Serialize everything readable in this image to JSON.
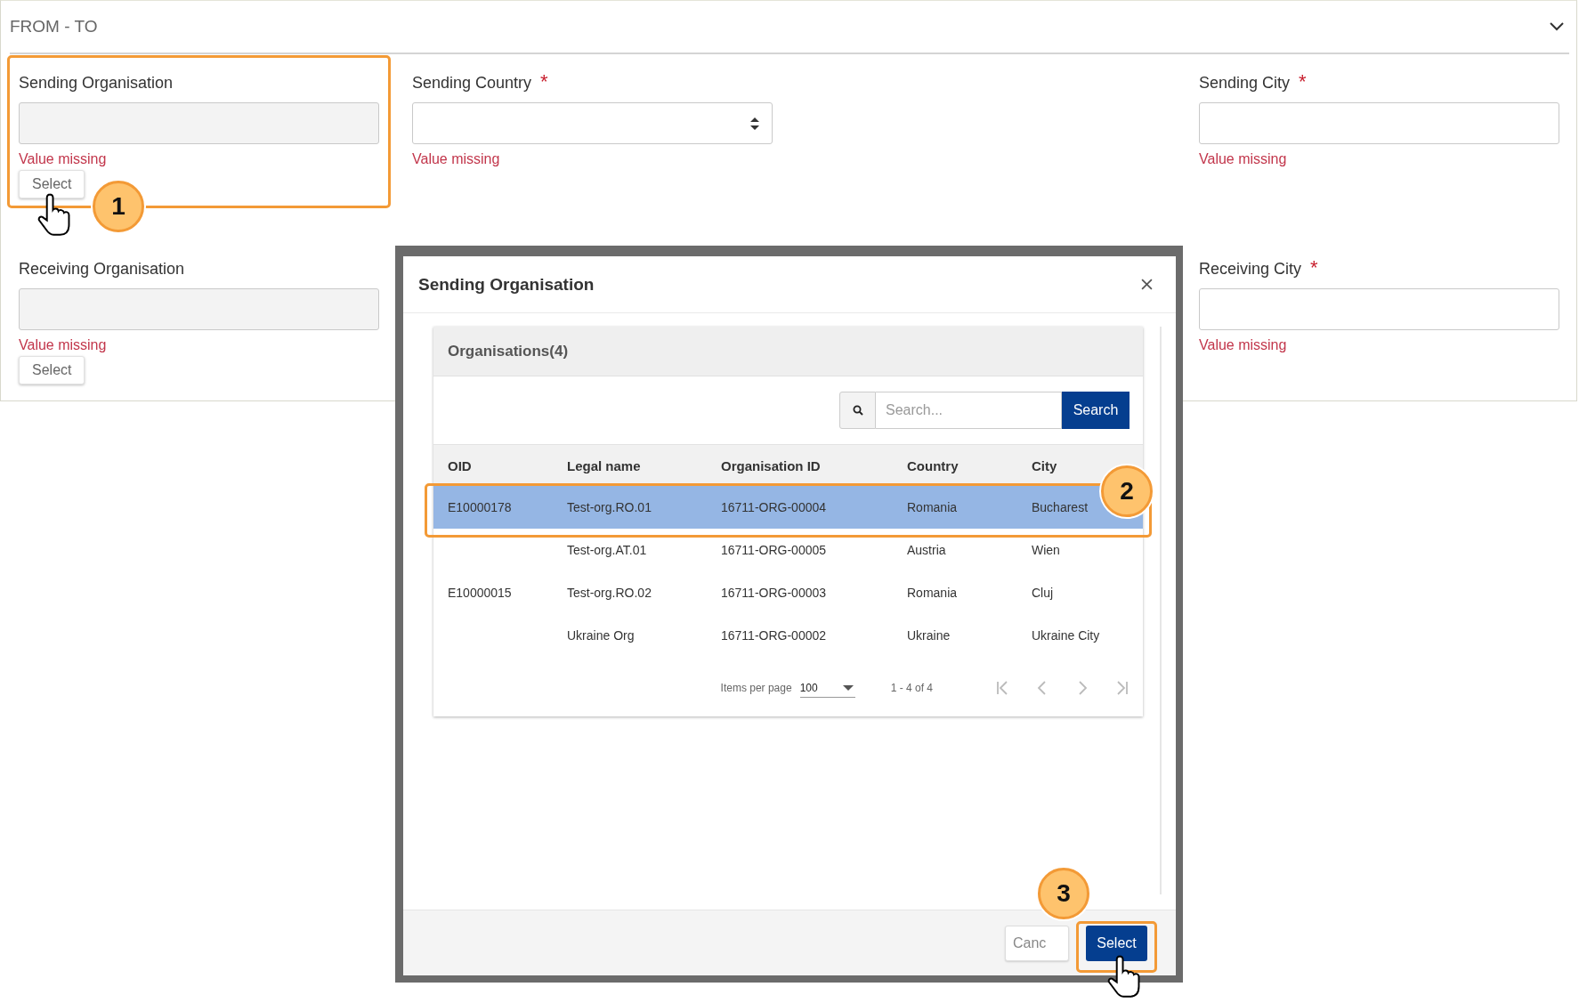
{
  "section": {
    "title": "FROM - TO",
    "expanded": true
  },
  "field_rows": [
    [
      {
        "kind": "picker",
        "label": "Sending Organisation",
        "error": "Value missing",
        "button": "Select"
      },
      {
        "kind": "select",
        "label": "Sending Country",
        "required_mark": "*",
        "error": "Value missing"
      },
      {
        "kind": "text",
        "label": "Sending City",
        "required_mark": "*",
        "error": "Value missing"
      }
    ],
    [
      {
        "kind": "picker",
        "label": "Receiving Organisation",
        "error": "Value missing",
        "button": "Select"
      },
      {
        "kind": "text",
        "label": "Receiving City",
        "required_mark": "*",
        "error": "Value missing"
      }
    ]
  ],
  "dialog": {
    "title": "Sending Organisation",
    "card_title": "Organisations(4)",
    "search": {
      "placeholder": "Search...",
      "button": "Search"
    },
    "columns": [
      "OID",
      "Legal name",
      "Organisation ID",
      "Country",
      "City"
    ],
    "rows": [
      {
        "cells": [
          "E10000178",
          "Test-org.RO.01",
          "16711-ORG-00004",
          "Romania",
          "Bucharest"
        ],
        "selected": true
      },
      {
        "cells": [
          "",
          "Test-org.AT.01",
          "16711-ORG-00005",
          "Austria",
          "Wien"
        ],
        "selected": false
      },
      {
        "cells": [
          "E10000015",
          "Test-org.RO.02",
          "16711-ORG-00003",
          "Romania",
          "Cluj"
        ],
        "selected": false
      },
      {
        "cells": [
          "",
          "Ukraine Org",
          "16711-ORG-00002",
          "Ukraine",
          "Ukraine City"
        ],
        "selected": false
      }
    ],
    "pagination": {
      "items_per_page_label": "Items per page",
      "page_size": "100",
      "range": "1 - 4 of 4"
    },
    "buttons": [
      {
        "kind": "secondary",
        "label": "Canc"
      },
      {
        "kind": "primary",
        "label": "Select"
      }
    ]
  },
  "callouts": [
    {
      "number": "1"
    },
    {
      "number": "2"
    },
    {
      "number": "3"
    }
  ]
}
